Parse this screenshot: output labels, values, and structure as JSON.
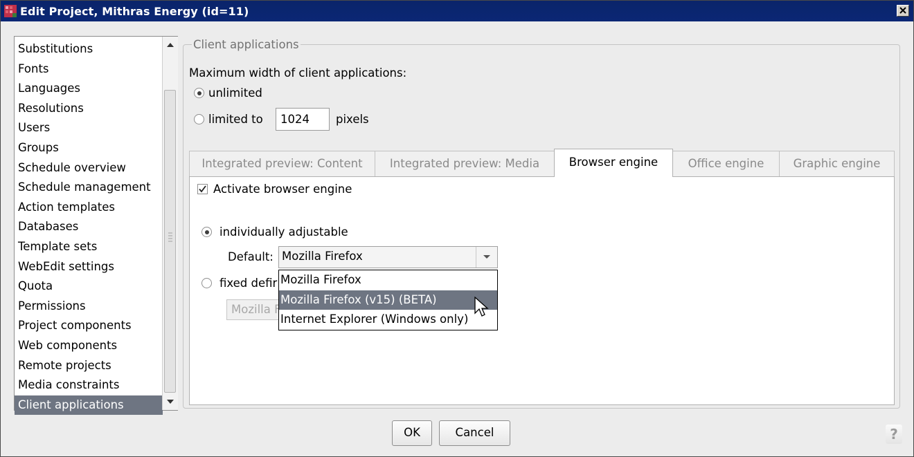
{
  "window": {
    "title": "Edit Project, Mithras Energy (id=11)"
  },
  "nav": {
    "items": [
      {
        "label": "Substitutions"
      },
      {
        "label": "Fonts"
      },
      {
        "label": "Languages"
      },
      {
        "label": "Resolutions"
      },
      {
        "label": "Users"
      },
      {
        "label": "Groups"
      },
      {
        "label": "Schedule overview"
      },
      {
        "label": "Schedule management"
      },
      {
        "label": "Action templates"
      },
      {
        "label": "Databases"
      },
      {
        "label": "Template sets"
      },
      {
        "label": "WebEdit settings"
      },
      {
        "label": "Quota"
      },
      {
        "label": "Permissions"
      },
      {
        "label": "Project components"
      },
      {
        "label": "Web components"
      },
      {
        "label": "Remote projects"
      },
      {
        "label": "Media constraints"
      },
      {
        "label": "Client applications"
      }
    ],
    "selected": "Client applications"
  },
  "client_apps": {
    "legend": "Client applications",
    "max_width_label": "Maximum width of client applications:",
    "unlimited_label": "unlimited",
    "unlimited_selected": true,
    "limited_label": "limited to",
    "limited_value": "1024",
    "pixels_label": "pixels"
  },
  "tabs": [
    {
      "label": "Integrated preview: Content",
      "active": false
    },
    {
      "label": "Integrated preview: Media",
      "active": false
    },
    {
      "label": "Browser engine",
      "active": true
    },
    {
      "label": "Office engine",
      "active": false
    },
    {
      "label": "Graphic engine",
      "active": false
    }
  ],
  "browser_engine": {
    "activate_label": "Activate browser engine",
    "activate_checked": true,
    "individual_label": "individually adjustable",
    "individual_selected": true,
    "default_label": "Default:",
    "default_value": "Mozilla Firefox",
    "fixed_label_visible": "fixed defir",
    "fixed_value_visible": "Mozilla F",
    "dropdown_options": [
      {
        "label": "Mozilla Firefox"
      },
      {
        "label": "Mozilla Firefox (v15) (BETA)"
      },
      {
        "label": "Internet Explorer (Windows only)"
      }
    ],
    "hovered_option": "Mozilla Firefox (v15) (BETA)"
  },
  "footer": {
    "ok_label": "OK",
    "cancel_label": "Cancel",
    "help_label": "?"
  },
  "colors": {
    "titlebar": "#0a246a",
    "selection": "#6e7582"
  }
}
